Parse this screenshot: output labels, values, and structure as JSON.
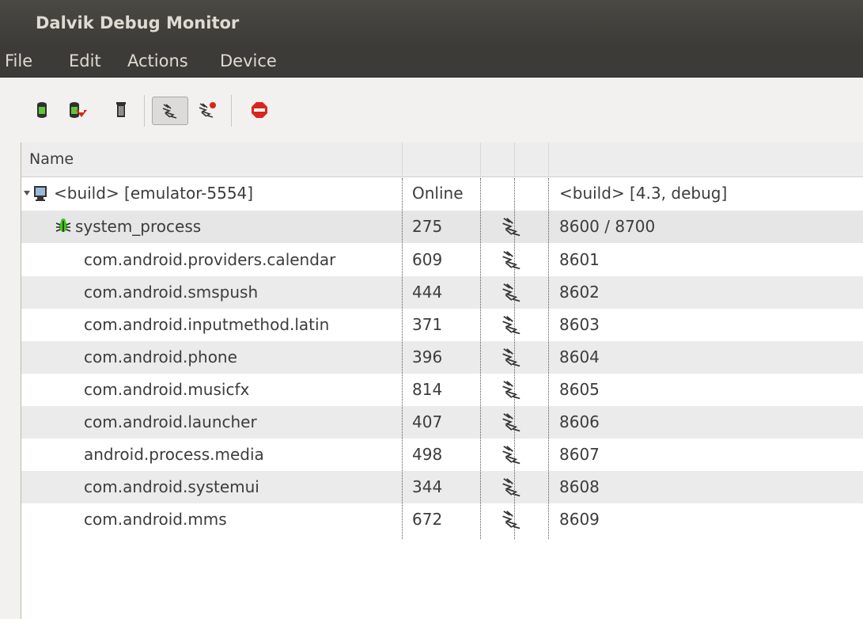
{
  "window": {
    "title": "Dalvik Debug Monitor"
  },
  "menu": [
    "File",
    "Edit",
    "Actions",
    "Device"
  ],
  "toolbar": {
    "buttons": [
      "update-heap",
      "dump-hprof",
      "cause-gc",
      "update-threads",
      "start-method-profiling",
      "stop-process"
    ]
  },
  "table": {
    "columns": [
      "Name",
      "",
      "",
      "",
      ""
    ],
    "device": {
      "name": "<build> [emulator-5554]",
      "state": "Online",
      "build": "<build> [4.3, debug]"
    },
    "rows": [
      {
        "name": "system_process",
        "pid": "275",
        "ports": "8600 / 8700"
      },
      {
        "name": "com.android.providers.calendar",
        "pid": "609",
        "ports": "8601"
      },
      {
        "name": "com.android.smspush",
        "pid": "444",
        "ports": "8602"
      },
      {
        "name": "com.android.inputmethod.latin",
        "pid": "371",
        "ports": "8603"
      },
      {
        "name": "com.android.phone",
        "pid": "396",
        "ports": "8604"
      },
      {
        "name": "com.android.musicfx",
        "pid": "814",
        "ports": "8605"
      },
      {
        "name": "com.android.launcher",
        "pid": "407",
        "ports": "8606"
      },
      {
        "name": "android.process.media",
        "pid": "498",
        "ports": "8607"
      },
      {
        "name": "com.android.systemui",
        "pid": "344",
        "ports": "8608"
      },
      {
        "name": "com.android.mms",
        "pid": "672",
        "ports": "8609"
      }
    ]
  },
  "colors": {
    "titlebar": "#3c3b37",
    "title_text": "#dfdbd2",
    "row_alt": "#ebebeb",
    "bug_green": "#44c41a"
  }
}
